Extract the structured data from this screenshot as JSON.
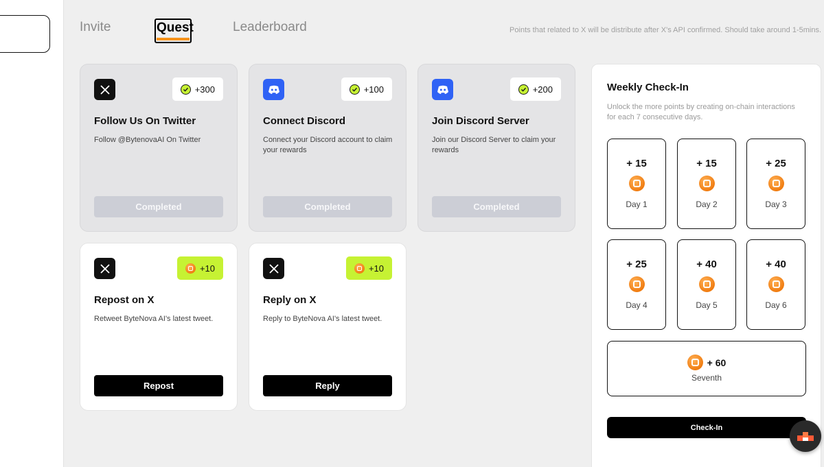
{
  "tabs": [
    {
      "label": "Invite"
    },
    {
      "label": "Quest"
    },
    {
      "label": "Leaderboard"
    }
  ],
  "notice": "Points that related to X will be distribute after X's API confirmed. Should take around 1-5mins.",
  "quests": [
    {
      "icon": "x-logo-icon",
      "reward": "+300",
      "title": "Follow Us On Twitter",
      "desc": "Follow @BytenovaAI On Twitter",
      "action": "Completed",
      "status": "completed"
    },
    {
      "icon": "discord-logo-icon",
      "reward": "+100",
      "title": "Connect Discord",
      "desc": "Connect your Discord account to claim your rewards",
      "action": "Completed",
      "status": "completed"
    },
    {
      "icon": "discord-logo-icon",
      "reward": "+200",
      "title": "Join Discord Server",
      "desc": "Join our Discord Server to claim your rewards",
      "action": "Completed",
      "status": "completed"
    },
    {
      "icon": "x-logo-icon",
      "reward": "+10",
      "title": "Repost on X",
      "desc": "Retweet ByteNova AI's latest tweet.",
      "action": "Repost",
      "status": "open"
    },
    {
      "icon": "x-logo-icon",
      "reward": "+10",
      "title": "Reply on X",
      "desc": "Reply to ByteNova AI's latest tweet.",
      "action": "Reply",
      "status": "open"
    }
  ],
  "checkin": {
    "title": "Weekly Check-In",
    "subtitle": "Unlock the more points by creating on-chain interactions for each 7 consecutive days.",
    "days": [
      {
        "amount": "+ 15",
        "label": "Day 1"
      },
      {
        "amount": "+ 15",
        "label": "Day 2"
      },
      {
        "amount": "+ 25",
        "label": "Day 3"
      },
      {
        "amount": "+ 25",
        "label": "Day 4"
      },
      {
        "amount": "+ 40",
        "label": "Day 5"
      },
      {
        "amount": "+ 40",
        "label": "Day 6"
      }
    ],
    "seventh": {
      "amount": "+ 60",
      "label": "Seventh"
    },
    "button": "Check-In"
  },
  "colors": {
    "accent_orange": "#f7931a",
    "lime": "#c6f233",
    "discord_blue": "#2f62f5",
    "completed_card": "#e4e4e6"
  }
}
